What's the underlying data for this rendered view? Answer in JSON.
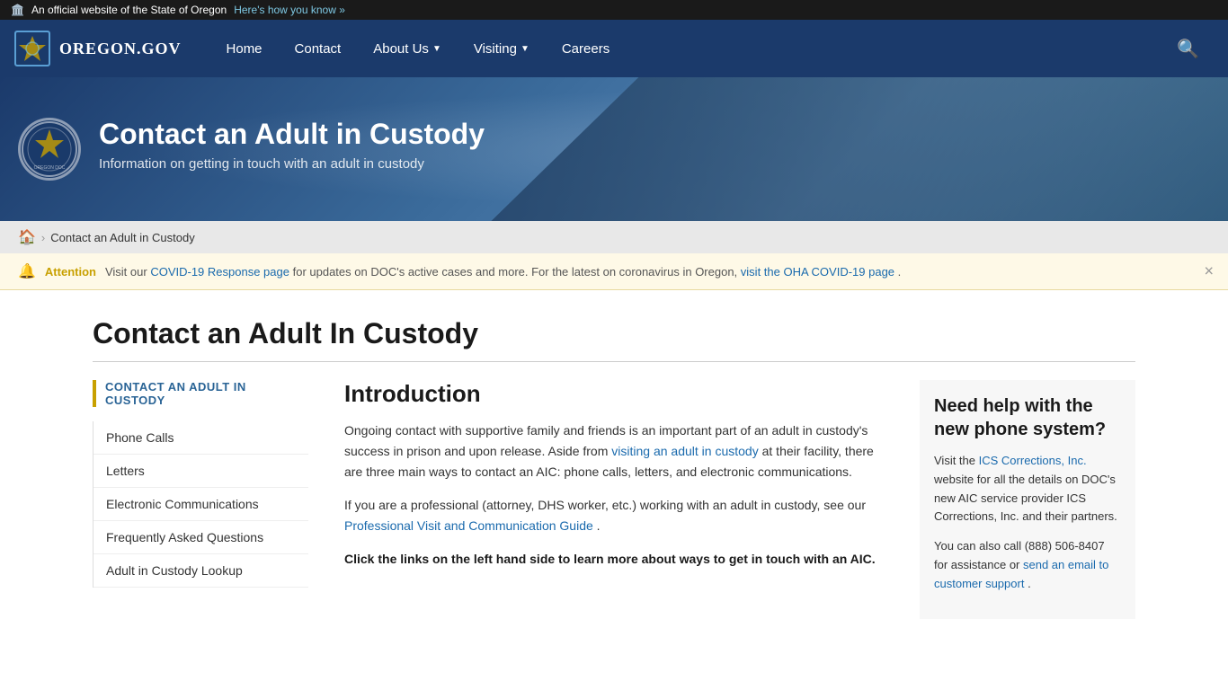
{
  "topbar": {
    "official_text": "An official website of the State of Oregon",
    "how_link": "Here's how you know »"
  },
  "nav": {
    "logo_text": "OREGON.GOV",
    "links": [
      {
        "label": "Home",
        "has_arrow": false
      },
      {
        "label": "Contact",
        "has_arrow": false
      },
      {
        "label": "About Us",
        "has_arrow": true
      },
      {
        "label": "Visiting",
        "has_arrow": true
      },
      {
        "label": "Careers",
        "has_arrow": false
      }
    ],
    "search_icon": "🔍"
  },
  "hero": {
    "seal_label": "Oregon Department of Corrections",
    "title": "Contact an Adult in Custody",
    "subtitle": "Information on getting in touch with an adult in custody"
  },
  "breadcrumb": {
    "home_label": "🏠",
    "separator": "›",
    "current": "Contact an Adult in Custody"
  },
  "attention": {
    "label": "Attention",
    "text_before": "Visit our",
    "covid_link": "COVID-19 Response page",
    "text_middle": "for updates on DOC's active cases and more. For the latest on coronavirus in Oregon,",
    "oha_link": "visit the OHA COVID-19 page",
    "text_after": ".",
    "close_icon": "×"
  },
  "page": {
    "title": "Contact an Adult In Custody"
  },
  "sidebar": {
    "active_label": "CONTACT AN ADULT IN CUSTODY",
    "nav_items": [
      {
        "label": "Phone Calls"
      },
      {
        "label": "Letters"
      },
      {
        "label": "Electronic Communications"
      },
      {
        "label": "Frequently Asked Questions"
      },
      {
        "label": "Adult in Custody Lookup"
      }
    ]
  },
  "main": {
    "intro_heading": "Introduction",
    "para1_before": "Ongoing contact with supportive family and friends is an important part of an adult in custody's success in prison and upon release. Aside from",
    "para1_link": "visiting an adult in custody",
    "para1_after": "at their facility, there are three main ways to contact an AIC: phone calls, letters, and electronic communications.",
    "para2_before": "If you are a professional (attorney, DHS worker, etc.) working with an adult in custody, see our",
    "para2_link": "Professional Visit and Communication Guide",
    "para2_after": ".",
    "para3_bold": "Click the links on the left hand side to learn more about ways to get in touch with an AIC."
  },
  "help_box": {
    "heading": "Need help with the new phone system?",
    "para1_before": "Visit the",
    "para1_link": "ICS Corrections, Inc.",
    "para1_after": "website for all the details on DOC's new AIC service provider ICS Corrections, Inc. and their partners.",
    "para2_before": "You can also call (888) 506-8407 for assistance or",
    "para2_link": "send an email to customer support",
    "para2_after": "."
  }
}
